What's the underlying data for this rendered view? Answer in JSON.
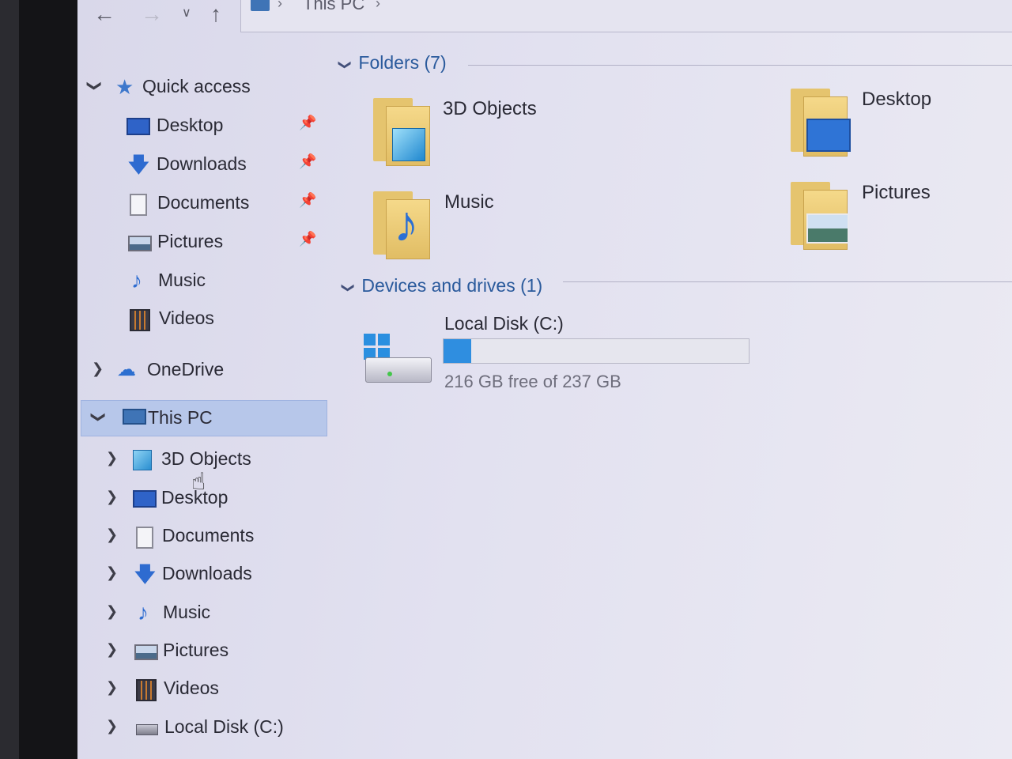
{
  "address": {
    "crumb": "This PC"
  },
  "sidebar": {
    "quick_access": {
      "label": "Quick access",
      "items": [
        {
          "label": "Desktop",
          "icon": "desktop-icon",
          "pinned": true
        },
        {
          "label": "Downloads",
          "icon": "downloads-icon",
          "pinned": true
        },
        {
          "label": "Documents",
          "icon": "documents-icon",
          "pinned": true
        },
        {
          "label": "Pictures",
          "icon": "pictures-icon",
          "pinned": true
        },
        {
          "label": "Music",
          "icon": "music-icon",
          "pinned": false
        },
        {
          "label": "Videos",
          "icon": "videos-icon",
          "pinned": false
        }
      ]
    },
    "onedrive": {
      "label": "OneDrive"
    },
    "this_pc": {
      "label": "This PC",
      "items": [
        {
          "label": "3D Objects",
          "icon": "3d-objects-icon"
        },
        {
          "label": "Desktop",
          "icon": "desktop-icon"
        },
        {
          "label": "Documents",
          "icon": "documents-icon"
        },
        {
          "label": "Downloads",
          "icon": "downloads-icon"
        },
        {
          "label": "Music",
          "icon": "music-icon"
        },
        {
          "label": "Pictures",
          "icon": "pictures-icon"
        },
        {
          "label": "Videos",
          "icon": "videos-icon"
        },
        {
          "label": "Local Disk (C:)",
          "icon": "drive-icon"
        }
      ]
    }
  },
  "main": {
    "folders_header": "Folders (7)",
    "folders": [
      {
        "name": "3D Objects",
        "icon": "3d-objects-folder-icon"
      },
      {
        "name": "Desktop",
        "icon": "desktop-folder-icon"
      },
      {
        "name": "Music",
        "icon": "music-folder-icon"
      },
      {
        "name": "Pictures",
        "icon": "pictures-folder-icon"
      }
    ],
    "devices_header": "Devices and drives (1)",
    "drive": {
      "name": "Local Disk (C:)",
      "free_text": "216 GB free of 237 GB",
      "used_fraction": 0.09
    }
  },
  "colors": {
    "accent": "#2f8ee0",
    "selection": "#b7c7ea",
    "group_header": "#2a5a9c"
  }
}
